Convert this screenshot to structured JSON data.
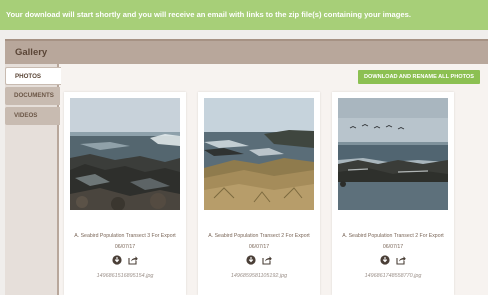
{
  "banner": {
    "message": "Your download will start shortly and you will receive an email with links to the zip file(s) containing your images."
  },
  "gallery": {
    "title": "Gallery",
    "tabs": [
      {
        "label": "PHOTOS",
        "active": true
      },
      {
        "label": "DOCUMENTS",
        "active": false
      },
      {
        "label": "VIDEOS",
        "active": false
      }
    ],
    "download_all_label": "DOWNLOAD AND RENAME ALL PHOTOS",
    "photos": [
      {
        "caption": "A. Seabird Population Transect 3 For Export",
        "date": "06/07/17",
        "filename": "1496861516895154.jpg"
      },
      {
        "caption": "A. Seabird Population Transect 2 For Export",
        "date": "06/07/17",
        "filename": "1496859581105192.jpg"
      },
      {
        "caption": "A. Seabird Population Transect 2 For Export",
        "date": "06/07/17",
        "filename": "1496861748558770.jpg"
      }
    ]
  },
  "colors": {
    "banner": "#a7cf78",
    "header": "#b8a79b",
    "button": "#8cc052",
    "text_brown": "#7a6658"
  },
  "icons": {
    "download": "download-circle-icon",
    "share": "share-arrow-icon"
  }
}
